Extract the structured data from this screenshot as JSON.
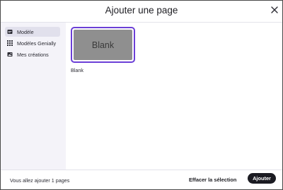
{
  "header": {
    "title": "Ajouter une page",
    "close_icon": "close-icon"
  },
  "sidebar": {
    "items": [
      {
        "label": "Modèle",
        "icon": "template-card-icon",
        "active": true
      },
      {
        "label": "Modèles Genially",
        "icon": "grid-icon",
        "active": false
      },
      {
        "label": "Mes créations",
        "icon": "image-icon",
        "active": false
      }
    ]
  },
  "main": {
    "templates": [
      {
        "thumbnail_text": "Blank",
        "label": "Blank",
        "selected": true
      }
    ]
  },
  "footer": {
    "info": "Vous allez ajouter 1 pages",
    "clear_label": "Effacer la sélection",
    "add_label": "Ajouter"
  },
  "colors": {
    "accent": "#6b3fd6",
    "sidebar_bg": "#f4f3f9",
    "primary_button": "#1b1b22"
  }
}
